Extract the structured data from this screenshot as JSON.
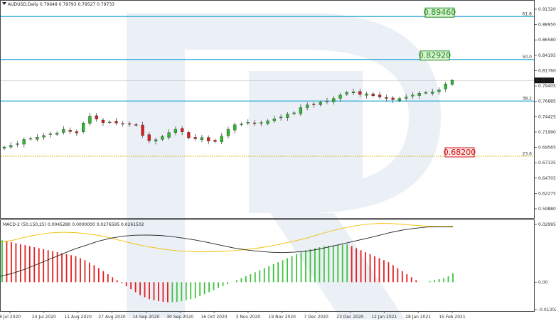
{
  "chart_data": [
    {
      "type": "candlestick",
      "title": "AUDUSD,Daily",
      "ohlc_header": "0.79648 0.79793 0.79527 0.79733",
      "current_price": "0.79733",
      "y_ticks": [
        "0.91320",
        "0.88950",
        "0.86580",
        "0.84195",
        "0.81760",
        "0.79405",
        "0.76885",
        "0.74425",
        "0.71990",
        "0.69565",
        "0.67135",
        "0.64705",
        "0.62275",
        "0.59880"
      ],
      "ylim": [
        0.5988,
        0.9132
      ],
      "x_ticks": [
        "8 Jul 2020",
        "24 Jul 2020",
        "11 Aug 2020",
        "27 Aug 2020",
        "14 Sep 2020",
        "30 Sep 2020",
        "16 Oct 2020",
        "3 Nov 2020",
        "19 Nov 2020",
        "7 Dec 2020",
        "23 Dec 2020",
        "12 Jan 2021",
        "28 Jan 2021",
        "15 Feb 2021"
      ],
      "closes": [
        0.696,
        0.6985,
        0.701,
        0.7075,
        0.709,
        0.711,
        0.7135,
        0.716,
        0.7175,
        0.723,
        0.7195,
        0.7175,
        0.7325,
        0.743,
        0.7385,
        0.733,
        0.734,
        0.7325,
        0.731,
        0.7315,
        0.7295,
        0.7135,
        0.7055,
        0.707,
        0.712,
        0.718,
        0.723,
        0.719,
        0.71,
        0.7085,
        0.7105,
        0.705,
        0.7045,
        0.7125,
        0.723,
        0.73,
        0.731,
        0.7335,
        0.732,
        0.733,
        0.736,
        0.739,
        0.7415,
        0.746,
        0.748,
        0.756,
        0.76,
        0.761,
        0.764,
        0.766,
        0.77,
        0.775,
        0.779,
        0.78,
        0.776,
        0.777,
        0.774,
        0.772,
        0.77,
        0.768,
        0.77,
        0.772,
        0.775,
        0.778,
        0.779,
        0.78,
        0.783,
        0.792,
        0.7973
      ],
      "fib_levels": [
        {
          "ratio": "61.8",
          "price": "0.89460",
          "color": "#2aa7d6",
          "box_text_color": "#1f8a24",
          "box_bg": "#d9f2d0"
        },
        {
          "ratio": "50.0",
          "price": "0.82920",
          "color": "#2aa7d6",
          "box_text_color": "#1f8a24",
          "box_bg": "#d9f2d0"
        },
        {
          "ratio": "38.2",
          "price": "",
          "color": "#2aa7d6"
        },
        {
          "ratio": "23.6",
          "price": "0.68200",
          "color": "#c9b400",
          "box_text_color": "#d01818",
          "box_bg": "#fde2e2"
        }
      ],
      "colors": {
        "bull": "#2fb52f",
        "bear": "#d42020",
        "wick": "#333333"
      }
    },
    {
      "type": "macd",
      "title": "MACD-2 (50,150,25) 0.0045280 0.0000000 0.0276595 0.0261502",
      "y_ticks": [
        "0.0299566",
        "0.00",
        "-0.0130225"
      ],
      "ylim": [
        -0.0130225,
        0.0299566
      ],
      "histogram": [
        0.021,
        0.0205,
        0.02,
        0.0195,
        0.019,
        0.0185,
        0.018,
        0.0175,
        0.017,
        0.0165,
        0.016,
        0.0155,
        0.015,
        0.0145,
        0.014,
        0.0135,
        0.013,
        0.012,
        0.011,
        0.0098,
        0.0085,
        0.007,
        0.0055,
        0.004,
        0.0025,
        0.001,
        -0.0005,
        -0.002,
        -0.0035,
        -0.005,
        -0.0065,
        -0.0075,
        -0.0085,
        -0.009,
        -0.0095,
        -0.0098,
        -0.01,
        -0.01,
        -0.0098,
        -0.0095,
        -0.009,
        -0.0085,
        -0.008,
        -0.007,
        -0.006,
        -0.005,
        -0.004,
        -0.003,
        -0.002,
        -0.001,
        0.0,
        0.001,
        0.002,
        0.003,
        0.004,
        0.005,
        0.006,
        0.007,
        0.008,
        0.009,
        0.01,
        0.011,
        0.012,
        0.013,
        0.014,
        0.015,
        0.016,
        0.0165,
        0.017,
        0.0175,
        0.018,
        0.0182,
        0.0184,
        0.0186,
        0.0188,
        0.019,
        0.018,
        0.017,
        0.016,
        0.015,
        0.014,
        0.013,
        0.012,
        0.011,
        0.01,
        0.0085,
        0.007,
        0.0055,
        0.004,
        0.0025,
        0.001,
        0.0,
        0.0,
        0.0005,
        0.001,
        0.0015,
        0.002,
        0.003,
        0.0045
      ],
      "histogram_colors": {
        "rising": "#3fc23f",
        "falling": "#e02020"
      },
      "macd_line": [
        0.003,
        0.0045,
        0.0065,
        0.009,
        0.0115,
        0.014,
        0.0165,
        0.0185,
        0.0205,
        0.022,
        0.023,
        0.0235,
        0.0236,
        0.0234,
        0.0228,
        0.022,
        0.021,
        0.0198,
        0.0185,
        0.0172,
        0.0162,
        0.0155,
        0.015,
        0.0148,
        0.015,
        0.0155,
        0.0165,
        0.0178,
        0.0192,
        0.0206,
        0.022,
        0.0235,
        0.025,
        0.0262,
        0.027,
        0.0276,
        0.0276,
        0.0277
      ],
      "signal_line": [
        0.02,
        0.021,
        0.0225,
        0.0238,
        0.0246,
        0.025,
        0.0248,
        0.0243,
        0.0234,
        0.0221,
        0.0205,
        0.019,
        0.0178,
        0.0168,
        0.016,
        0.0155,
        0.0152,
        0.0152,
        0.0154,
        0.0158,
        0.0163,
        0.017,
        0.018,
        0.0192,
        0.0205,
        0.022,
        0.0238,
        0.0255,
        0.027,
        0.0282,
        0.029,
        0.0294,
        0.0293,
        0.0289,
        0.0284,
        0.028,
        0.0278,
        0.028
      ],
      "line_colors": {
        "macd": "#222222",
        "signal": "#f0c000"
      }
    }
  ]
}
